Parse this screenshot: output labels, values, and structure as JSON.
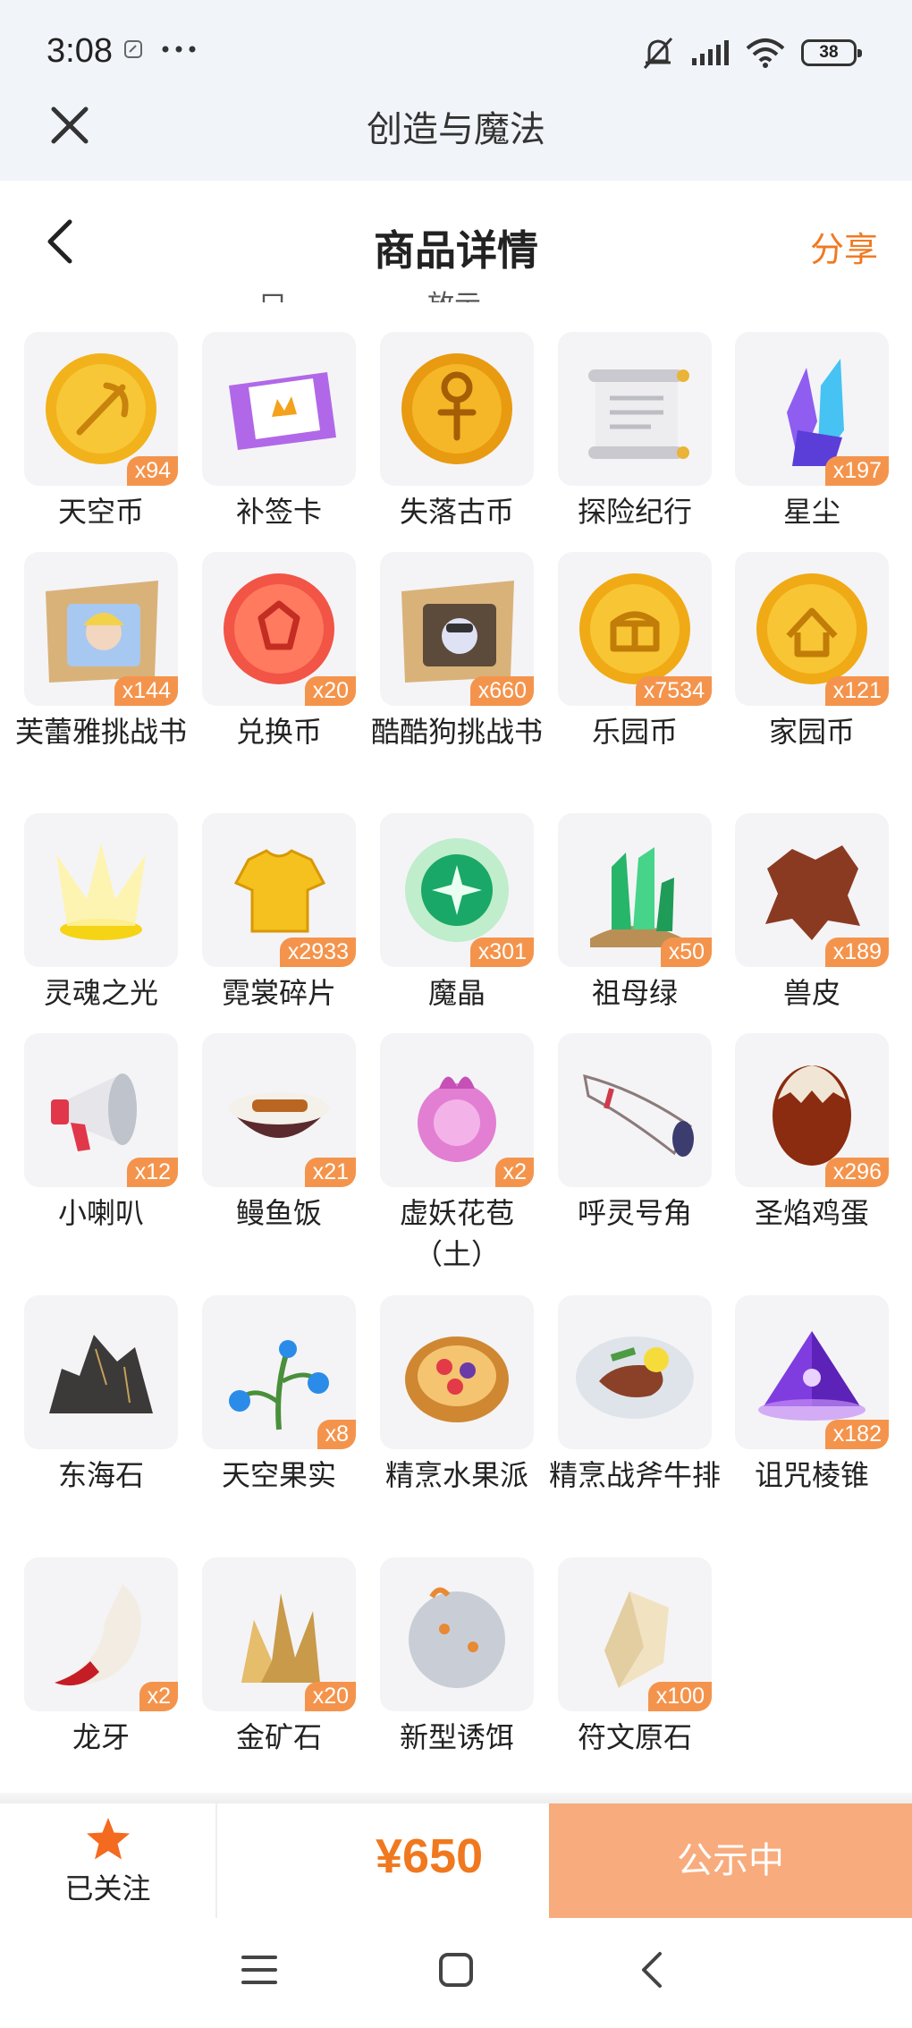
{
  "status_bar": {
    "time": "3:08",
    "battery": "38"
  },
  "webview": {
    "title": "创造与魔法"
  },
  "header": {
    "title": "商品详情",
    "share": "分享"
  },
  "partial_row_top": [
    "口",
    "放示"
  ],
  "items": [
    {
      "name": "天空币",
      "qty": "x94",
      "icon": "sky-coin-icon"
    },
    {
      "name": "补签卡",
      "qty": "",
      "icon": "makeup-card-icon"
    },
    {
      "name": "失落古币",
      "qty": "",
      "icon": "lost-coin-icon"
    },
    {
      "name": "探险纪行",
      "qty": "",
      "icon": "scroll-icon"
    },
    {
      "name": "星尘",
      "qty": "x197",
      "icon": "stardust-crystal-icon"
    },
    {
      "name": "芙蕾雅挑战书",
      "qty": "x144",
      "icon": "wanted-poster-icon"
    },
    {
      "name": "兑换币",
      "qty": "x20",
      "icon": "exchange-coin-icon"
    },
    {
      "name": "酷酷狗挑战书",
      "qty": "x660",
      "icon": "wanted-poster-dog-icon"
    },
    {
      "name": "乐园币",
      "qty": "x7534",
      "icon": "park-coin-icon"
    },
    {
      "name": "家园币",
      "qty": "x121",
      "icon": "home-coin-icon"
    },
    {
      "name": "灵魂之光",
      "qty": "",
      "icon": "soul-light-icon"
    },
    {
      "name": "霓裳碎片",
      "qty": "x2933",
      "icon": "shirt-fragment-icon"
    },
    {
      "name": "魔晶",
      "qty": "x301",
      "icon": "magic-crystal-icon"
    },
    {
      "name": "祖母绿",
      "qty": "x50",
      "icon": "emerald-icon"
    },
    {
      "name": "兽皮",
      "qty": "x189",
      "icon": "hide-icon"
    },
    {
      "name": "小喇叭",
      "qty": "x12",
      "icon": "megaphone-icon"
    },
    {
      "name": "鳗鱼饭",
      "qty": "x21",
      "icon": "eel-rice-icon"
    },
    {
      "name": "虚妖花苞（土）",
      "qty": "x2",
      "icon": "flower-bud-icon"
    },
    {
      "name": "呼灵号角",
      "qty": "",
      "icon": "horn-icon"
    },
    {
      "name": "圣焰鸡蛋",
      "qty": "x296",
      "icon": "egg-icon"
    },
    {
      "name": "东海石",
      "qty": "",
      "icon": "rock-icon"
    },
    {
      "name": "天空果实",
      "qty": "x8",
      "icon": "sky-fruit-plant-icon"
    },
    {
      "name": "精烹水果派",
      "qty": "",
      "icon": "fruit-pie-icon"
    },
    {
      "name": "精烹战斧牛排",
      "qty": "",
      "icon": "steak-icon"
    },
    {
      "name": "诅咒棱锥",
      "qty": "x182",
      "icon": "cursed-pyramid-icon"
    },
    {
      "name": "龙牙",
      "qty": "x2",
      "icon": "dragon-tooth-icon"
    },
    {
      "name": "金矿石",
      "qty": "x20",
      "icon": "gold-ore-icon"
    },
    {
      "name": "新型诱饵",
      "qty": "",
      "icon": "bait-icon"
    },
    {
      "name": "符文原石",
      "qty": "x100",
      "icon": "rune-stone-icon"
    }
  ],
  "bottom": {
    "follow_label": "已关注",
    "price": "¥650",
    "action": "公示中"
  },
  "colors": {
    "accent": "#f0781e",
    "badge": "#f4944c",
    "action_bg": "#f8ab7c"
  }
}
